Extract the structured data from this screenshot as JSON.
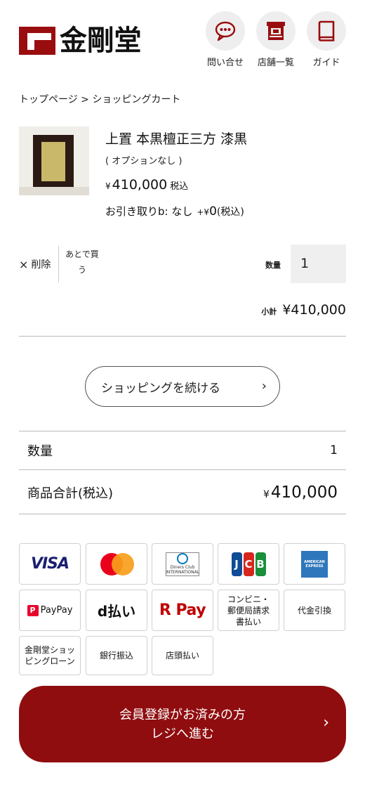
{
  "header": {
    "logo_text": "金剛堂",
    "nav": [
      {
        "label": "問い合せ",
        "icon": "chat-icon"
      },
      {
        "label": "店舗一覧",
        "icon": "store-icon"
      },
      {
        "label": "ガイド",
        "icon": "book-icon"
      }
    ]
  },
  "breadcrumb": "トップページ > ショッピングカート",
  "cart_item": {
    "name": "上置 本黒檀正三方 漆黒",
    "option": "( オプションなし )",
    "price_yen": "¥",
    "price": "410,000",
    "price_tax": "税込",
    "pickup_label": "お引き取りb: なし",
    "pickup_plus": "+¥",
    "pickup_amount": "0",
    "pickup_tax": "(税込)",
    "delete_label": "削除",
    "delete_x": "×",
    "later_label": "あとで買う",
    "qty_label": "数量",
    "qty_value": "1",
    "subtotal_label": "小計",
    "subtotal_value": "¥410,000"
  },
  "continue_button": "ショッピングを続ける",
  "summary": {
    "qty_label": "数量",
    "qty_value": "1",
    "total_label": "商品合計(税込)",
    "total_yen": "¥",
    "total_value": "410,000"
  },
  "payments": {
    "visa": "VISA",
    "diners": "Diners Club INTERNATIONAL",
    "jcb": [
      "J",
      "C",
      "B"
    ],
    "amex": "AMERICAN EXPRESS",
    "paypay": "PayPay",
    "paypay_mark": "P",
    "dpay": "d払い",
    "rpay": "R Pay",
    "convenience": "コンビニ・郵便局請求書払い",
    "cod": "代金引換",
    "loan": "金剛堂ショッピングローン",
    "bank": "銀行振込",
    "store": "店頭払い"
  },
  "cta": {
    "line1": "会員登録がお済みの方",
    "line2": "レジへ進む"
  },
  "colors": {
    "brand_red": "#8f0d0f",
    "jcb_blue": "#0e4c96",
    "jcb_red": "#d7261e",
    "jcb_green": "#1a8f3b"
  }
}
